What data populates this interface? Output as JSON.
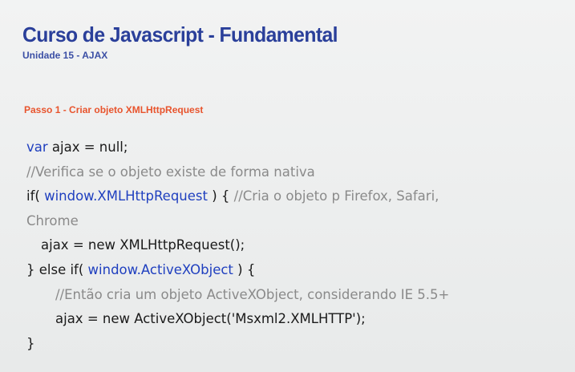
{
  "slide": {
    "title": "Curso de Javascript - Fundamental",
    "subtitle": "Unidade 15 - AJAX",
    "step": "Passo 1 - Criar objeto XMLHttpRequest"
  },
  "code": {
    "l1_kw": "var",
    "l1_rest": " ajax = null;",
    "l2_comment": "//Verifica se o objeto existe de forma nativa",
    "l3_a": "if( ",
    "l3_kw": "window.XMLHttpRequest",
    "l3_b": " ) {  ",
    "l3_comment": "  //Cria o objeto p Firefox, Safari,",
    "l4_comment": "Chrome",
    "l5": "ajax = new XMLHttpRequest();",
    "l6_a": "} else if( ",
    "l6_kw": "window.ActiveXObject",
    "l6_b": " ) {",
    "l7_comment": "//Então cria um objeto ActiveXObject, considerando IE 5.5+",
    "l8": "ajax = new ActiveXObject('Msxml2.XMLHTTP');",
    "l9": "}"
  },
  "colors": {
    "title": "#2a3f9a",
    "step": "#e8542d",
    "keyword": "#1f3fbf",
    "comment": "#8a8a8a"
  }
}
